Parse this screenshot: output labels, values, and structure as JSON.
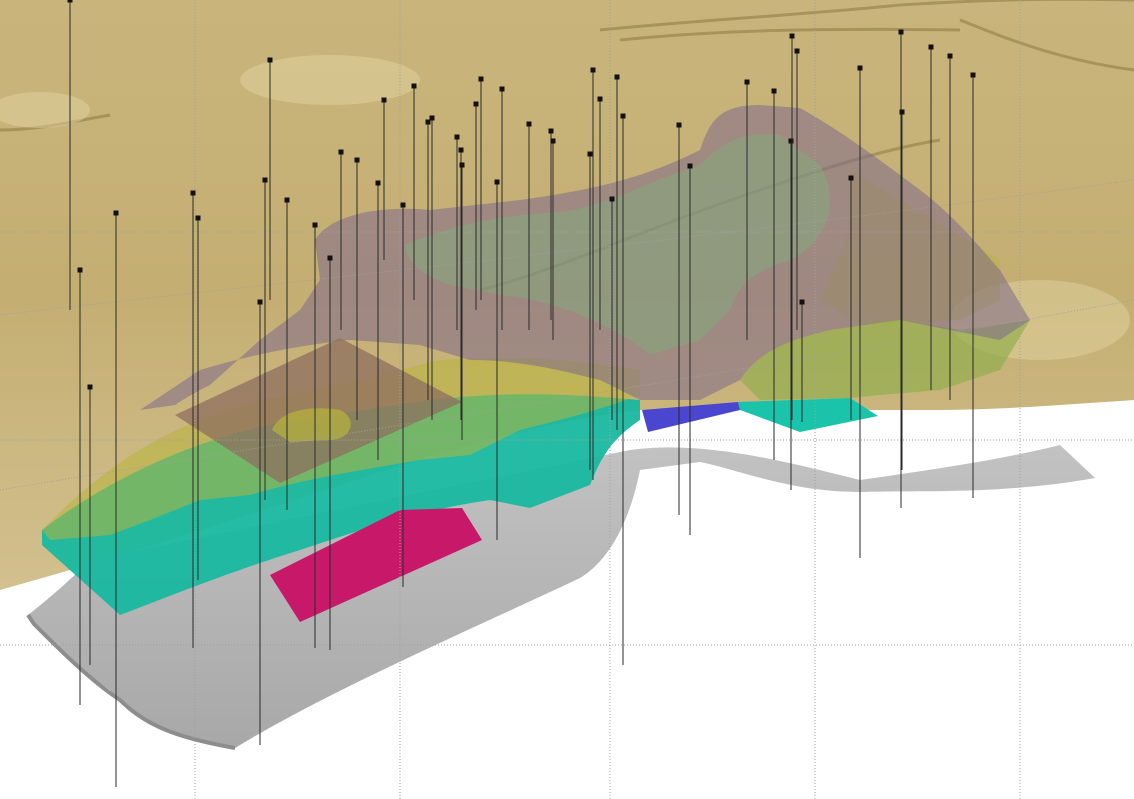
{
  "scene": {
    "kind": "3d-geological-model-viewport",
    "background_color": "#ffffff",
    "terrain_color": "#c8b276",
    "terrain_shadow_color": "#8f7d45",
    "grid_color": "#9a9a9a",
    "layers": [
      {
        "id": "topographic-surface",
        "color": "#c8b276"
      },
      {
        "id": "basement-surface",
        "color": "#b5b5b5"
      },
      {
        "id": "teal-layer",
        "color": "#19b8a0"
      },
      {
        "id": "olive-layer",
        "color": "#b8b43a"
      },
      {
        "id": "green-layer",
        "color": "#8fae4a"
      },
      {
        "id": "purple-layer",
        "color": "#7f6a8c"
      },
      {
        "id": "brown-layer",
        "color": "#8d6f5f"
      },
      {
        "id": "magenta-body",
        "color": "#c8186a"
      },
      {
        "id": "blue-body",
        "color": "#4a46cf"
      }
    ],
    "drillhole_collar_color": "#111111",
    "drillhole_trace_color": "#2a2a2a"
  }
}
